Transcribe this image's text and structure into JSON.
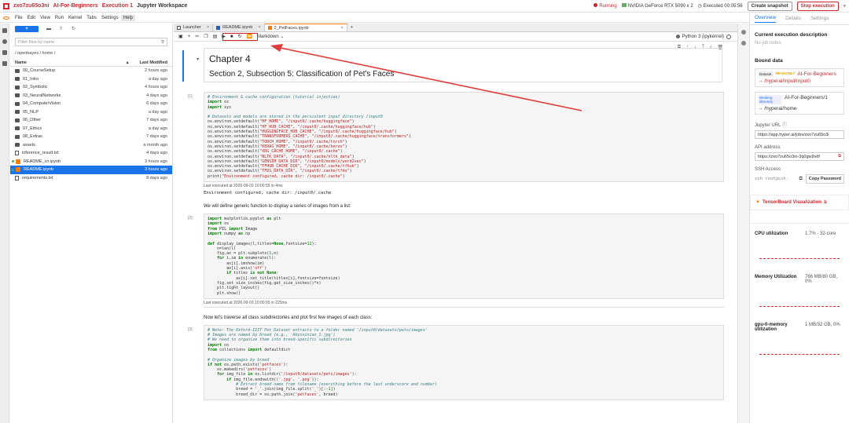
{
  "topbar": {
    "job_id": "zxo7zu65o3ni",
    "project": "AI-For-Beginners",
    "execution": "Execution 1",
    "workspace": "Jupyter Workspace",
    "status": "Running",
    "gpu": "NVIDIA GeForce RTX 5090 x 2",
    "executed": "Executed 00:05:56",
    "snapshot_label": "Create snapshot",
    "stop_label": "Stop execution",
    "collapse_glyph": "»"
  },
  "menu": [
    "File",
    "Edit",
    "View",
    "Run",
    "Kernel",
    "Tabs",
    "Settings",
    "Help"
  ],
  "filebrowser": {
    "filter_placeholder": "Filter files by name",
    "path": "/ openbayes / home /",
    "col_name": "Name",
    "col_modified": "Last Modified",
    "items": [
      {
        "name": "00_CourseSetup",
        "modified": "2 hours ago",
        "type": "folder"
      },
      {
        "name": "01_Intro",
        "modified": "a day ago",
        "type": "folder"
      },
      {
        "name": "02_Symbolic",
        "modified": "4 hours ago",
        "type": "folder"
      },
      {
        "name": "03_NeuralNetworks",
        "modified": "4 days ago",
        "type": "folder"
      },
      {
        "name": "04_ComputerVision",
        "modified": "6 days ago",
        "type": "folder"
      },
      {
        "name": "05_NLP",
        "modified": "a day ago",
        "type": "folder"
      },
      {
        "name": "06_Other",
        "modified": "7 days ago",
        "type": "folder"
      },
      {
        "name": "07_Ethics",
        "modified": "a day ago",
        "type": "folder"
      },
      {
        "name": "08_Extras",
        "modified": "7 days ago",
        "type": "folder"
      },
      {
        "name": "assets",
        "modified": "a month ago",
        "type": "folder"
      },
      {
        "name": "inference_result.txt",
        "modified": "4 days ago",
        "type": "file"
      },
      {
        "name": "README_cn.ipynb",
        "modified": "3 hours ago",
        "type": "notebook"
      },
      {
        "name": "README.ipynb",
        "modified": "3 hours ago",
        "type": "notebook"
      },
      {
        "name": "requirements.txt",
        "modified": "8 days ago",
        "type": "file"
      }
    ]
  },
  "tabs": [
    {
      "label": "Launcher"
    },
    {
      "label": "README.ipynb"
    },
    {
      "label": "2_PetFaces.ipynb"
    }
  ],
  "nb_toolbar": {
    "cell_type": "Markdown",
    "kernel": "Python 3 (ipykernel)"
  },
  "notebook": {
    "h1": "Chapter 4",
    "h2": "Section 2, Subsection 5: Classification of Pet's Faces",
    "cell1_prompt": "[1]:",
    "cell1_meta": "Last executed at 2026-09-03 10:00:55 in 4ms",
    "cell1_output": "Environment configured, cache dir: /input0/.cache",
    "prose1": "We will define generic function to display a series of images from a list:",
    "cell2_prompt": "[2]:",
    "cell2_meta": "Last executed at 2026-09-03 10:00:55 in 225ms",
    "prose2": "Now let's traverse all class subdirectories and plot first few images of each class:",
    "cell3_prompt": "[3]:"
  },
  "rpanel": {
    "tab_overview": "Overview",
    "tab_details": "Details",
    "tab_settings": "Settings",
    "exec_desc_title": "Current execution description",
    "no_notes": "No job notes",
    "bound_data": "Bound data",
    "ds_badge": "Dataset",
    "ro_badge": "READONLY",
    "ds_name": "AI-For-Beginners",
    "ds_path": "→ /hyperai/input/input0",
    "wd_badge": "Working directory",
    "wd_name": "AI-For-Beginners/1",
    "wd_path": "→ /hyperai/home",
    "jupyter_label": "Jupyter URL ⓘ",
    "jupyter_url": "https://app.hyper.ai/jobs/zxo7zu65o3i",
    "api_label": "API address",
    "api_url": "https://zxo7zu65o3ni-3q0gw9vdf",
    "ssh_label": "SSH Access",
    "ssh_cmd": "ssh root@ssh.",
    "copy_pw": "Copy Password",
    "tensorboard": "TensorBoard Visualization",
    "cpu_label": "CPU utilization",
    "cpu_value": "1.7% - 32-core",
    "mem_label": "Memory Utilization",
    "mem_value": "766 MB/80 GB, 0%",
    "gpu_label": "gpu-0-memory utilization",
    "gpu_value": "1 MB/32 GB, 0%"
  },
  "colors": {
    "accent": "#d0252b",
    "blue": "#1a73e8"
  }
}
